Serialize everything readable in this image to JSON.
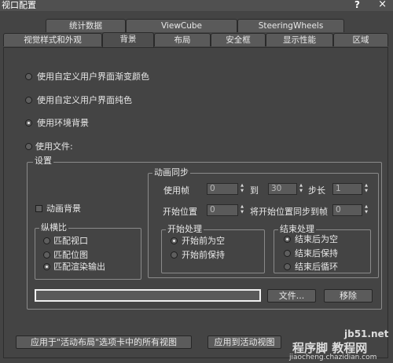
{
  "window": {
    "title": "视口配置",
    "help_glyph": "?",
    "close_glyph": "×"
  },
  "tabs_row1": [
    {
      "label": "统计数据"
    },
    {
      "label": "ViewCube"
    },
    {
      "label": "SteeringWheels"
    }
  ],
  "tabs_row2": [
    {
      "label": "视觉样式和外观"
    },
    {
      "label": "背景",
      "active": true
    },
    {
      "label": "布局"
    },
    {
      "label": "安全框"
    },
    {
      "label": "显示性能"
    },
    {
      "label": "区域"
    }
  ],
  "background_options": [
    {
      "label": "使用自定义用户界面渐变颜色",
      "selected": false
    },
    {
      "label": "使用自定义用户界面纯色",
      "selected": false
    },
    {
      "label": "使用环境背景",
      "selected": true
    },
    {
      "label": "使用文件:",
      "selected": false
    }
  ],
  "settings": {
    "title": "设置",
    "animate_bg_label": "动画背景",
    "animate_bg_checked": false,
    "aspect": {
      "title": "纵横比",
      "options": [
        {
          "label": "匹配视口",
          "selected": false
        },
        {
          "label": "匹配位图",
          "selected": false
        },
        {
          "label": "匹配渲染输出",
          "selected": true
        }
      ]
    },
    "anim_sync": {
      "title": "动画同步",
      "use_frames_label": "使用帧",
      "from_value": "0",
      "to_label": "到",
      "to_value": "30",
      "step_label": "步长",
      "step_value": "1",
      "start_label": "开始位置",
      "start_value": "0",
      "sync_label": "将开始位置同步到帧",
      "sync_value": "0",
      "start_processing": {
        "title": "开始处理",
        "options": [
          {
            "label": "开始前为空",
            "selected": true
          },
          {
            "label": "开始前保持",
            "selected": false
          }
        ]
      },
      "end_processing": {
        "title": "结束处理",
        "options": [
          {
            "label": "结束后为空",
            "selected": true
          },
          {
            "label": "结束后保持",
            "selected": false
          },
          {
            "label": "结束后循环",
            "selected": false
          }
        ]
      }
    },
    "file_path": "",
    "file_button": "文件...",
    "remove_button": "移除"
  },
  "bottom": {
    "apply_all_button": "应用于\"活动布局\"选项卡中的所有视图",
    "apply_active_button": "应用到活动视图"
  },
  "watermark": {
    "line1": "jb51.net",
    "line2": "程序脚 教程网 ",
    "line3": "jiaocheng.chazidian.com"
  }
}
